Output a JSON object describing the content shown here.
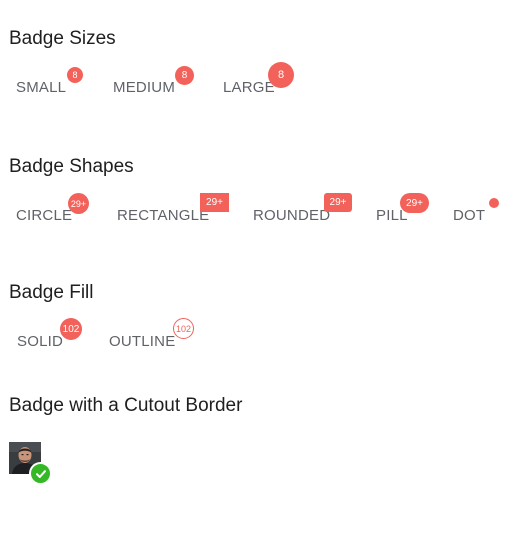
{
  "colors": {
    "badge": "#f2625a",
    "label": "#5f6368",
    "success": "#35b825"
  },
  "sizes": {
    "title": "Badge Sizes",
    "items": [
      {
        "label": "SMALL",
        "badge": "8"
      },
      {
        "label": "MEDIUM",
        "badge": "8"
      },
      {
        "label": "LARGE",
        "badge": "8"
      }
    ]
  },
  "shapes": {
    "title": "Badge Shapes",
    "items": [
      {
        "label": "CIRCLE",
        "badge": "29+"
      },
      {
        "label": "RECTANGLE",
        "badge": "29+"
      },
      {
        "label": "ROUNDED",
        "badge": "29+"
      },
      {
        "label": "PILL",
        "badge": "29+"
      },
      {
        "label": "DOT",
        "badge": ""
      }
    ]
  },
  "fill": {
    "title": "Badge Fill",
    "items": [
      {
        "label": "SOLID",
        "badge": "102"
      },
      {
        "label": "OUTLINE",
        "badge": "102"
      }
    ]
  },
  "cutout": {
    "title": "Badge with a Cutout Border",
    "avatar_icon": "user-avatar",
    "status_icon": "checkmark-icon"
  }
}
